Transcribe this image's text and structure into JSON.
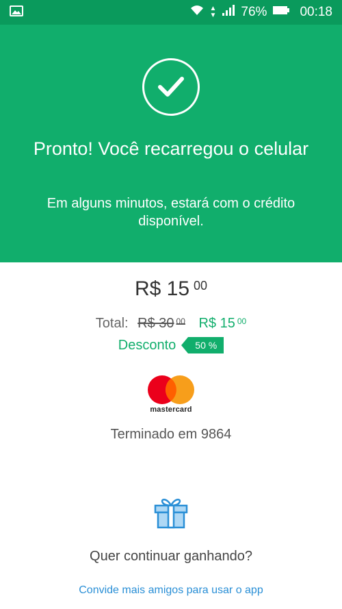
{
  "status_bar": {
    "battery": "76%",
    "time": "00:18",
    "icons": [
      "image-icon",
      "wifi-icon",
      "signal-icon",
      "battery-icon"
    ]
  },
  "hero": {
    "title": "Pronto! Você recarregou o celular",
    "subtitle": "Em alguns minutos, estará com o crédito disponível.",
    "icon": "check-circle-icon"
  },
  "amount": {
    "main": "R$ 15",
    "cents": "00"
  },
  "total": {
    "label": "Total:",
    "old_main": "R$ 30",
    "old_cents": "00",
    "new_main": "R$ 15",
    "new_cents": "00"
  },
  "discount": {
    "label": "Desconto",
    "badge": "50 %"
  },
  "payment": {
    "brand": "mastercard",
    "ending": "Terminado em 9864"
  },
  "promo": {
    "icon": "gift-icon",
    "question": "Quer continuar ganhando?",
    "link": "Convide mais amigos para usar o app"
  },
  "colors": {
    "status_bar": "#0a9a5c",
    "hero_bg": "#11ae6c",
    "accent": "#11ae6c",
    "link": "#2a8fd6"
  }
}
